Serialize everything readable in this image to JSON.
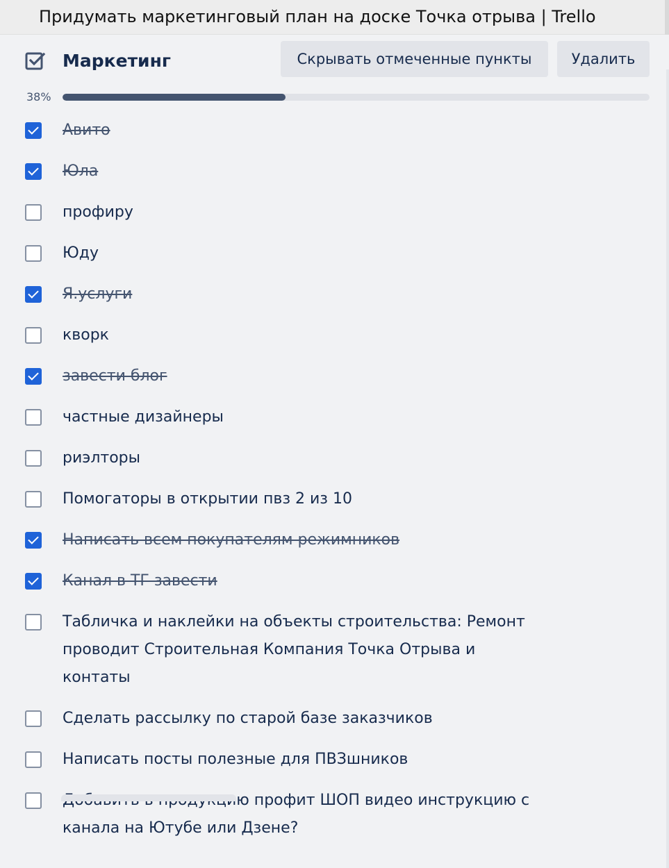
{
  "window": {
    "title": "Придумать маркетинговый план на доске Точка отрыва | Trello"
  },
  "checklist": {
    "title": "Маркетинг",
    "icon": "checklist-icon",
    "hide_button_label": "Скрывать отмеченные пункты",
    "delete_button_label": "Удалить",
    "progress_label": "38%",
    "progress_fraction": 0.38,
    "accent_color": "#1f63d8",
    "items": [
      {
        "text": "Авито",
        "checked": true
      },
      {
        "text": "Юла",
        "checked": true
      },
      {
        "text": "профиру",
        "checked": false
      },
      {
        "text": "Юду",
        "checked": false
      },
      {
        "text": "Я.услуги",
        "checked": true
      },
      {
        "text": "кворк",
        "checked": false
      },
      {
        "text": "завести блог",
        "checked": true
      },
      {
        "text": "частные дизайнеры",
        "checked": false
      },
      {
        "text": "риэлторы",
        "checked": false
      },
      {
        "text": "Помогаторы в открытии пвз 2 из 10",
        "checked": false
      },
      {
        "text": "Написать всем покупателям режимников",
        "checked": true
      },
      {
        "text": "Канал в ТГ завести",
        "checked": true
      },
      {
        "text": "Табличка и наклейки на объекты строительства: Ремонт проводит Строительная Компания Точка Отрыва и контаты",
        "checked": false
      },
      {
        "text": "Сделать рассылку по старой базе заказчиков",
        "checked": false
      },
      {
        "text": "Написать посты полезные для ПВЗшников",
        "checked": false
      },
      {
        "text": "Добавить в продукцию профит ШОП видео инструкцию с канала на Ютубе или Дзене?",
        "checked": false
      }
    ]
  }
}
